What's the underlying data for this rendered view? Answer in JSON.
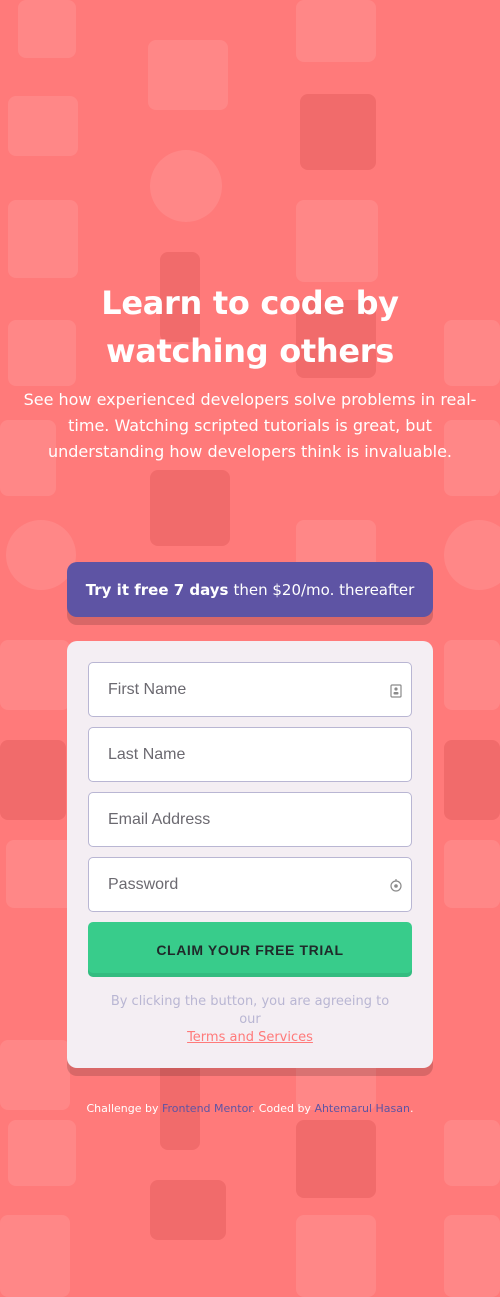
{
  "hero": {
    "title": "Learn to code by watching others",
    "description": "See how experienced developers solve problems in real-time. Watching scripted tutorials is great, but understanding how developers think is invaluable."
  },
  "offer": {
    "highlight": "Try it free 7 days",
    "rest": "then $20/mo. thereafter"
  },
  "form": {
    "first_name_placeholder": "First Name",
    "last_name_placeholder": "Last Name",
    "email_placeholder": "Email Address",
    "password_placeholder": "Password",
    "cta_label": "CLAIM YOUR FREE TRIAL",
    "terms_prefix": "By clicking the button, you are agreeing to our",
    "terms_link": "Terms and Services"
  },
  "footer": {
    "challenge_prefix": "Challenge by",
    "challenge_link": "Frontend Mentor",
    "coded_prefix": ". Coded by",
    "author_link": "Ahtemarul Hasan",
    "suffix": "."
  },
  "colors": {
    "background": "#ff7a7a",
    "banner": "#5e54a4",
    "card": "#f4eef3",
    "cta": "#38cc8b",
    "link_accent": "#5e54a4",
    "terms_link": "#ff7a7a"
  },
  "icons": {
    "first_name": "contact-card-icon",
    "password": "password-reveal-icon"
  }
}
